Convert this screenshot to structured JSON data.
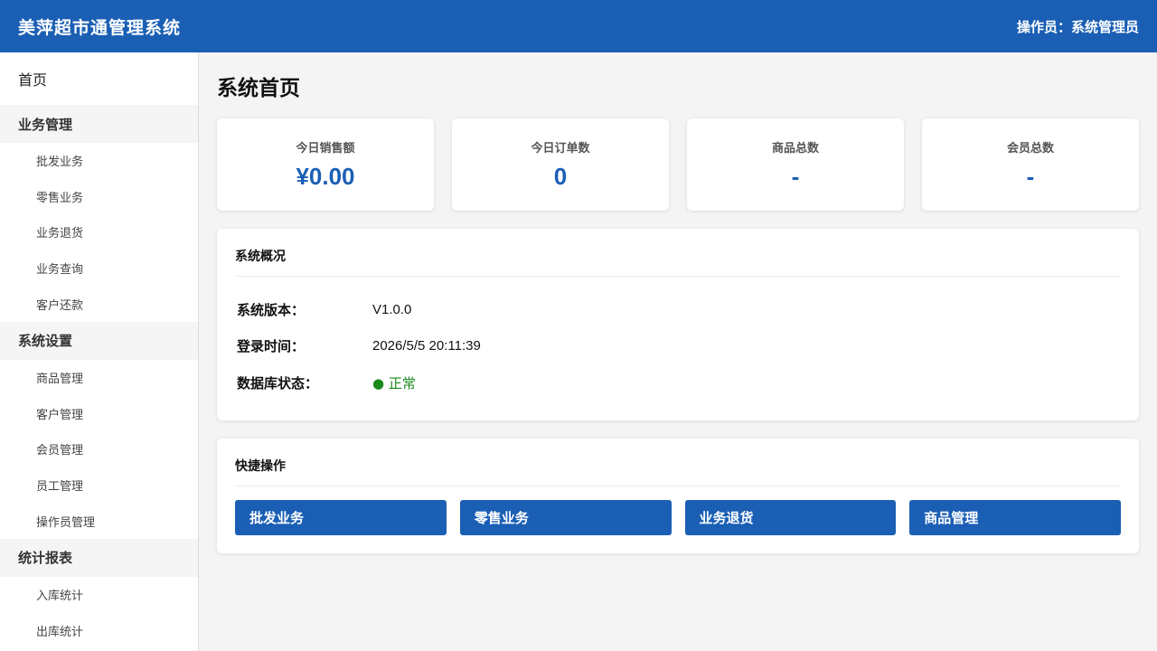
{
  "header": {
    "app_title": "美萍超市通管理系统",
    "operator": "操作员：系统管理员"
  },
  "sidebar": {
    "home": "首页",
    "groups": [
      {
        "title": "业务管理",
        "items": [
          "批发业务",
          "零售业务",
          "业务退货",
          "业务查询",
          "客户还款"
        ]
      },
      {
        "title": "系统设置",
        "items": [
          "商品管理",
          "客户管理",
          "会员管理",
          "员工管理",
          "操作员管理"
        ]
      },
      {
        "title": "统计报表",
        "items": [
          "入库统计",
          "出库统计"
        ]
      }
    ]
  },
  "main": {
    "page_title": "系统首页",
    "stats": [
      {
        "label": "今日销售额",
        "value": "¥0.00"
      },
      {
        "label": "今日订单数",
        "value": "0"
      },
      {
        "label": "商品总数",
        "value": "-"
      },
      {
        "label": "会员总数",
        "value": "-"
      }
    ],
    "overview": {
      "title": "系统概况",
      "rows": [
        {
          "key": "系统版本：",
          "value": "V1.0.0"
        },
        {
          "key": "登录时间：",
          "value": "2026/5/5 20:11:39"
        },
        {
          "key": "数据库状态：",
          "value": "● 正常"
        }
      ]
    },
    "quick": {
      "title": "快捷操作",
      "buttons": [
        "批发业务",
        "零售业务",
        "业务退货",
        "商品管理"
      ]
    }
  },
  "colors": {
    "primary": "#1b5fb5",
    "status_ok": "#1a8a1a"
  }
}
